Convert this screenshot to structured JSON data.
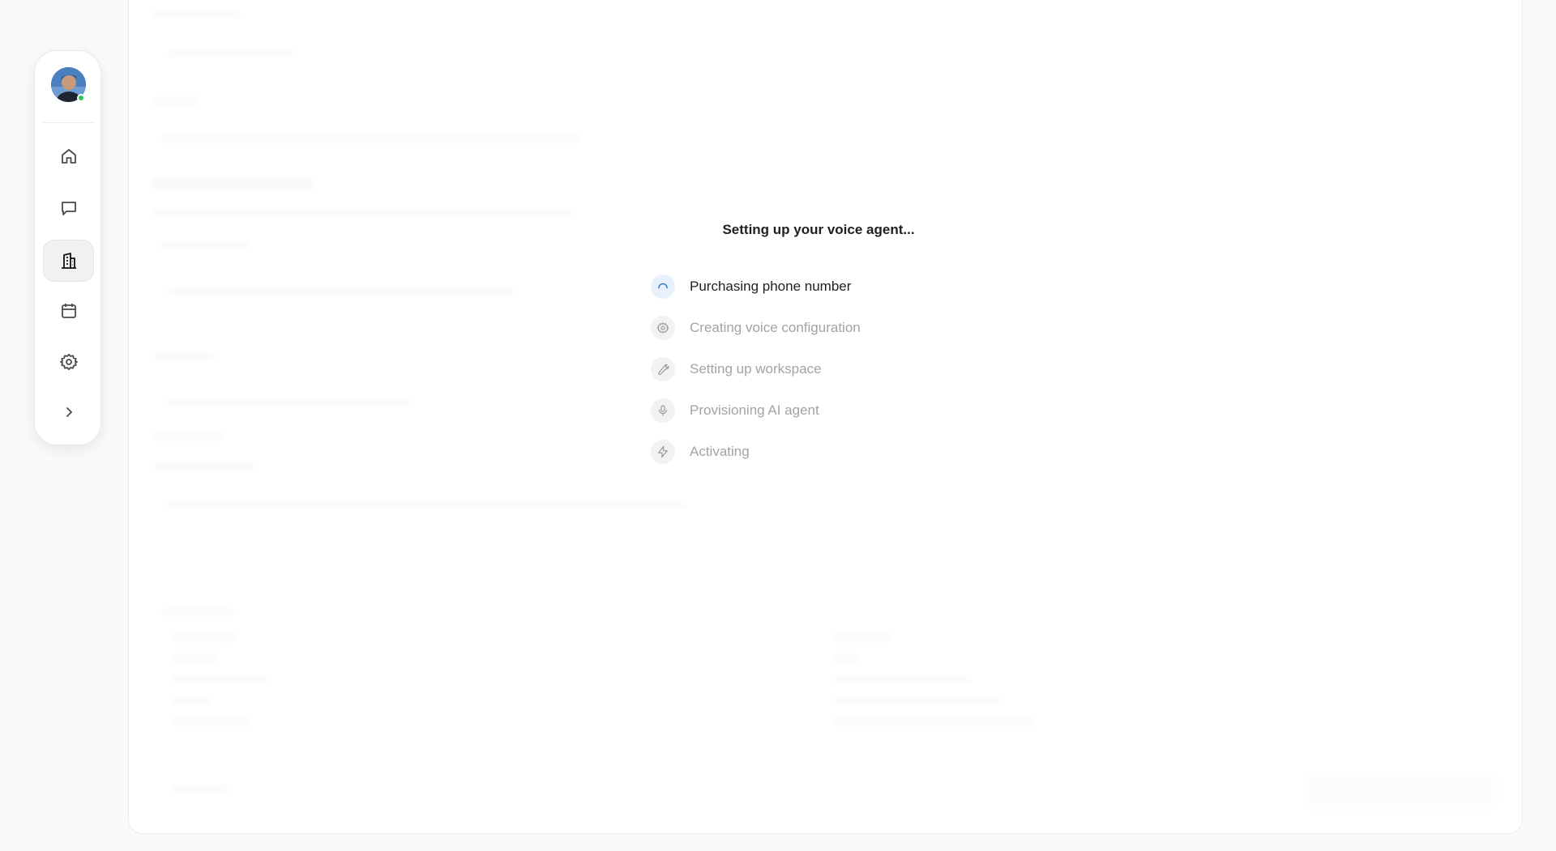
{
  "sidebar": {
    "avatar_name": "avatar",
    "status": "online",
    "nav": [
      {
        "id": "home",
        "icon": "home-icon"
      },
      {
        "id": "messages",
        "icon": "message-square-icon"
      },
      {
        "id": "organization",
        "icon": "building-icon",
        "active": true
      },
      {
        "id": "calendar",
        "icon": "calendar-icon"
      },
      {
        "id": "settings",
        "icon": "gear-icon"
      },
      {
        "id": "expand",
        "icon": "chevron-right-icon"
      }
    ]
  },
  "setup": {
    "title": "Setting up your voice agent...",
    "steps": [
      {
        "label": "Purchasing phone number",
        "icon": "spinner-icon",
        "state": "active"
      },
      {
        "label": "Creating voice configuration",
        "icon": "gear-icon",
        "state": "pending"
      },
      {
        "label": "Setting up workspace",
        "icon": "wrench-icon",
        "state": "pending"
      },
      {
        "label": "Provisioning AI agent",
        "icon": "microphone-icon",
        "state": "pending"
      },
      {
        "label": "Activating",
        "icon": "lightning-icon",
        "state": "pending"
      }
    ]
  },
  "colors": {
    "accent": "#3b82c4",
    "online": "#31c45a",
    "active_text": "#1f1f1f",
    "pending_text": "#a3a3a3"
  }
}
